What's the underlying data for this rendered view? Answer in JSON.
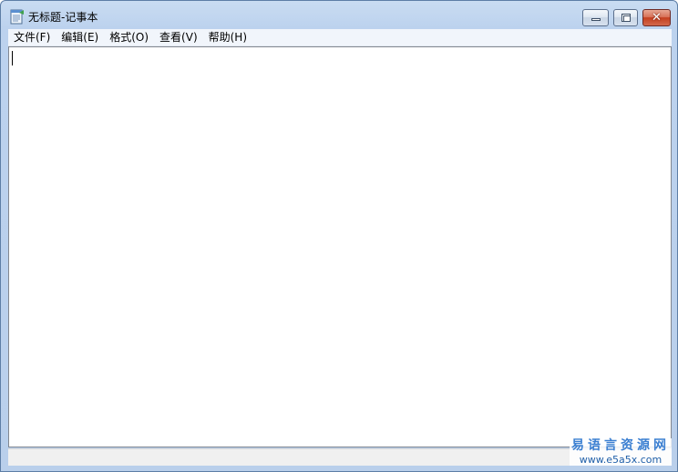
{
  "window": {
    "title": "无标题-记事本"
  },
  "caption_buttons": {
    "minimize_icon": "minimize-icon",
    "maximize_icon": "maximize-icon",
    "close_icon": "close-icon",
    "close_glyph": "✕"
  },
  "menu": {
    "items": [
      {
        "label": "文件(F)"
      },
      {
        "label": "编辑(E)"
      },
      {
        "label": "格式(O)"
      },
      {
        "label": "查看(V)"
      },
      {
        "label": "帮助(H)"
      }
    ]
  },
  "editor": {
    "content": ""
  },
  "watermark": {
    "name": "易语言资源网",
    "url": "www.e5a5x.com"
  },
  "colors": {
    "frame": "#b9cfeb",
    "menubar": "#f1f5fb",
    "close_button": "#c43f1f",
    "watermark": "#3b7fd1"
  }
}
